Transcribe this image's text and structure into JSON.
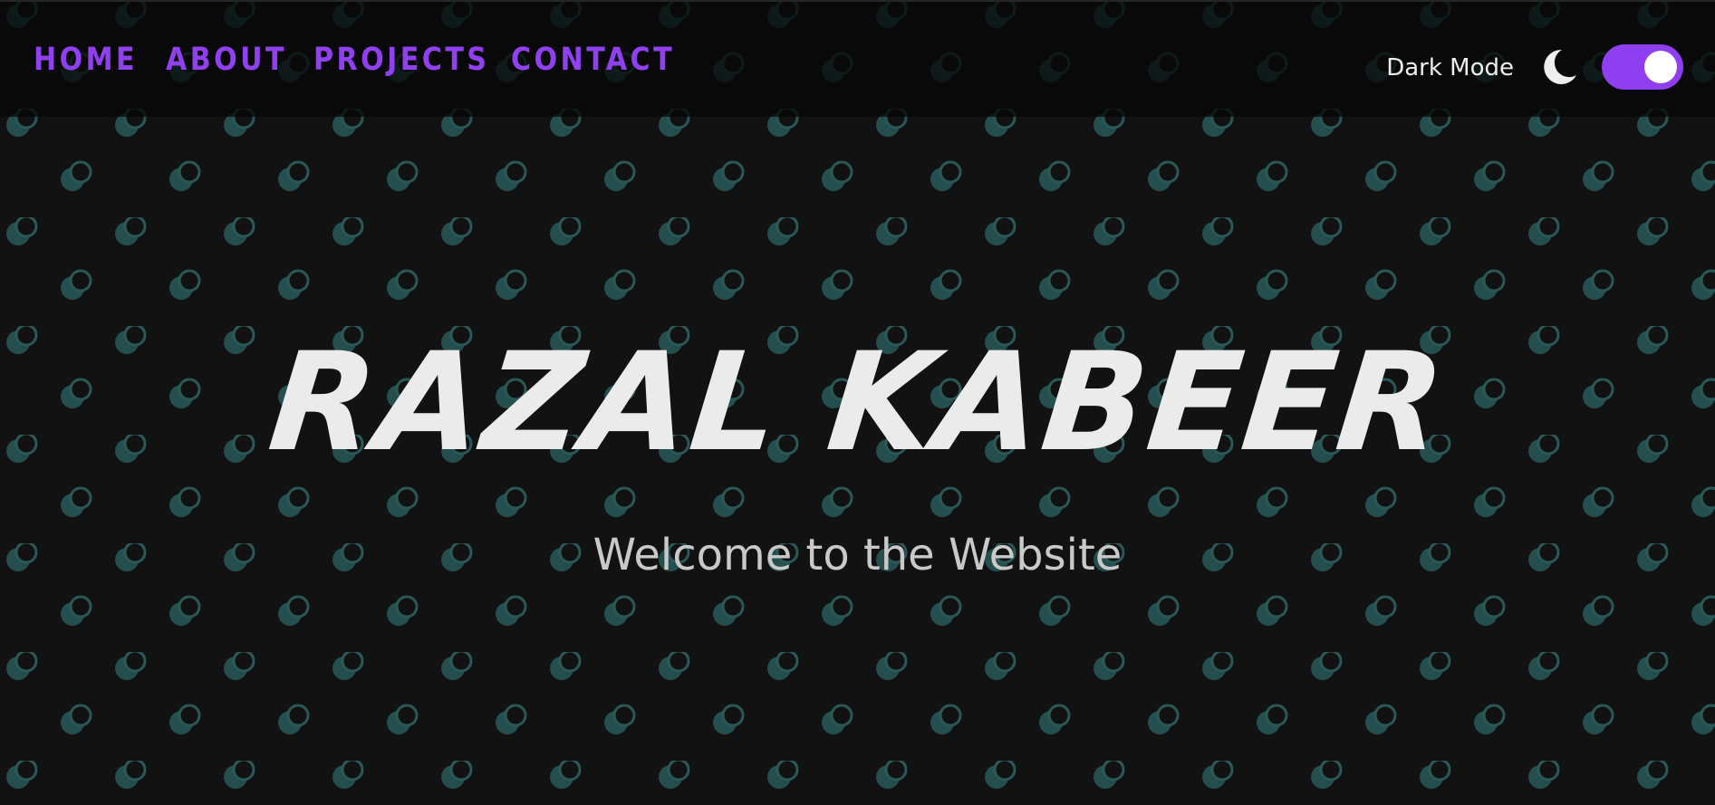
{
  "nav": {
    "links": [
      {
        "label": "HOME"
      },
      {
        "label": "ABOUT"
      },
      {
        "label": "PROJECTS"
      },
      {
        "label": "CONTACT"
      }
    ]
  },
  "theme_toggle": {
    "label": "Dark Mode",
    "icon": "moon-icon",
    "enabled": true
  },
  "hero": {
    "title": "RAZAL KABEER",
    "subtitle": "Welcome to the Website"
  },
  "colors": {
    "background": "#121212",
    "accent": "#8f3ff0",
    "pattern": "#2a5857",
    "text": "#ebebeb"
  }
}
